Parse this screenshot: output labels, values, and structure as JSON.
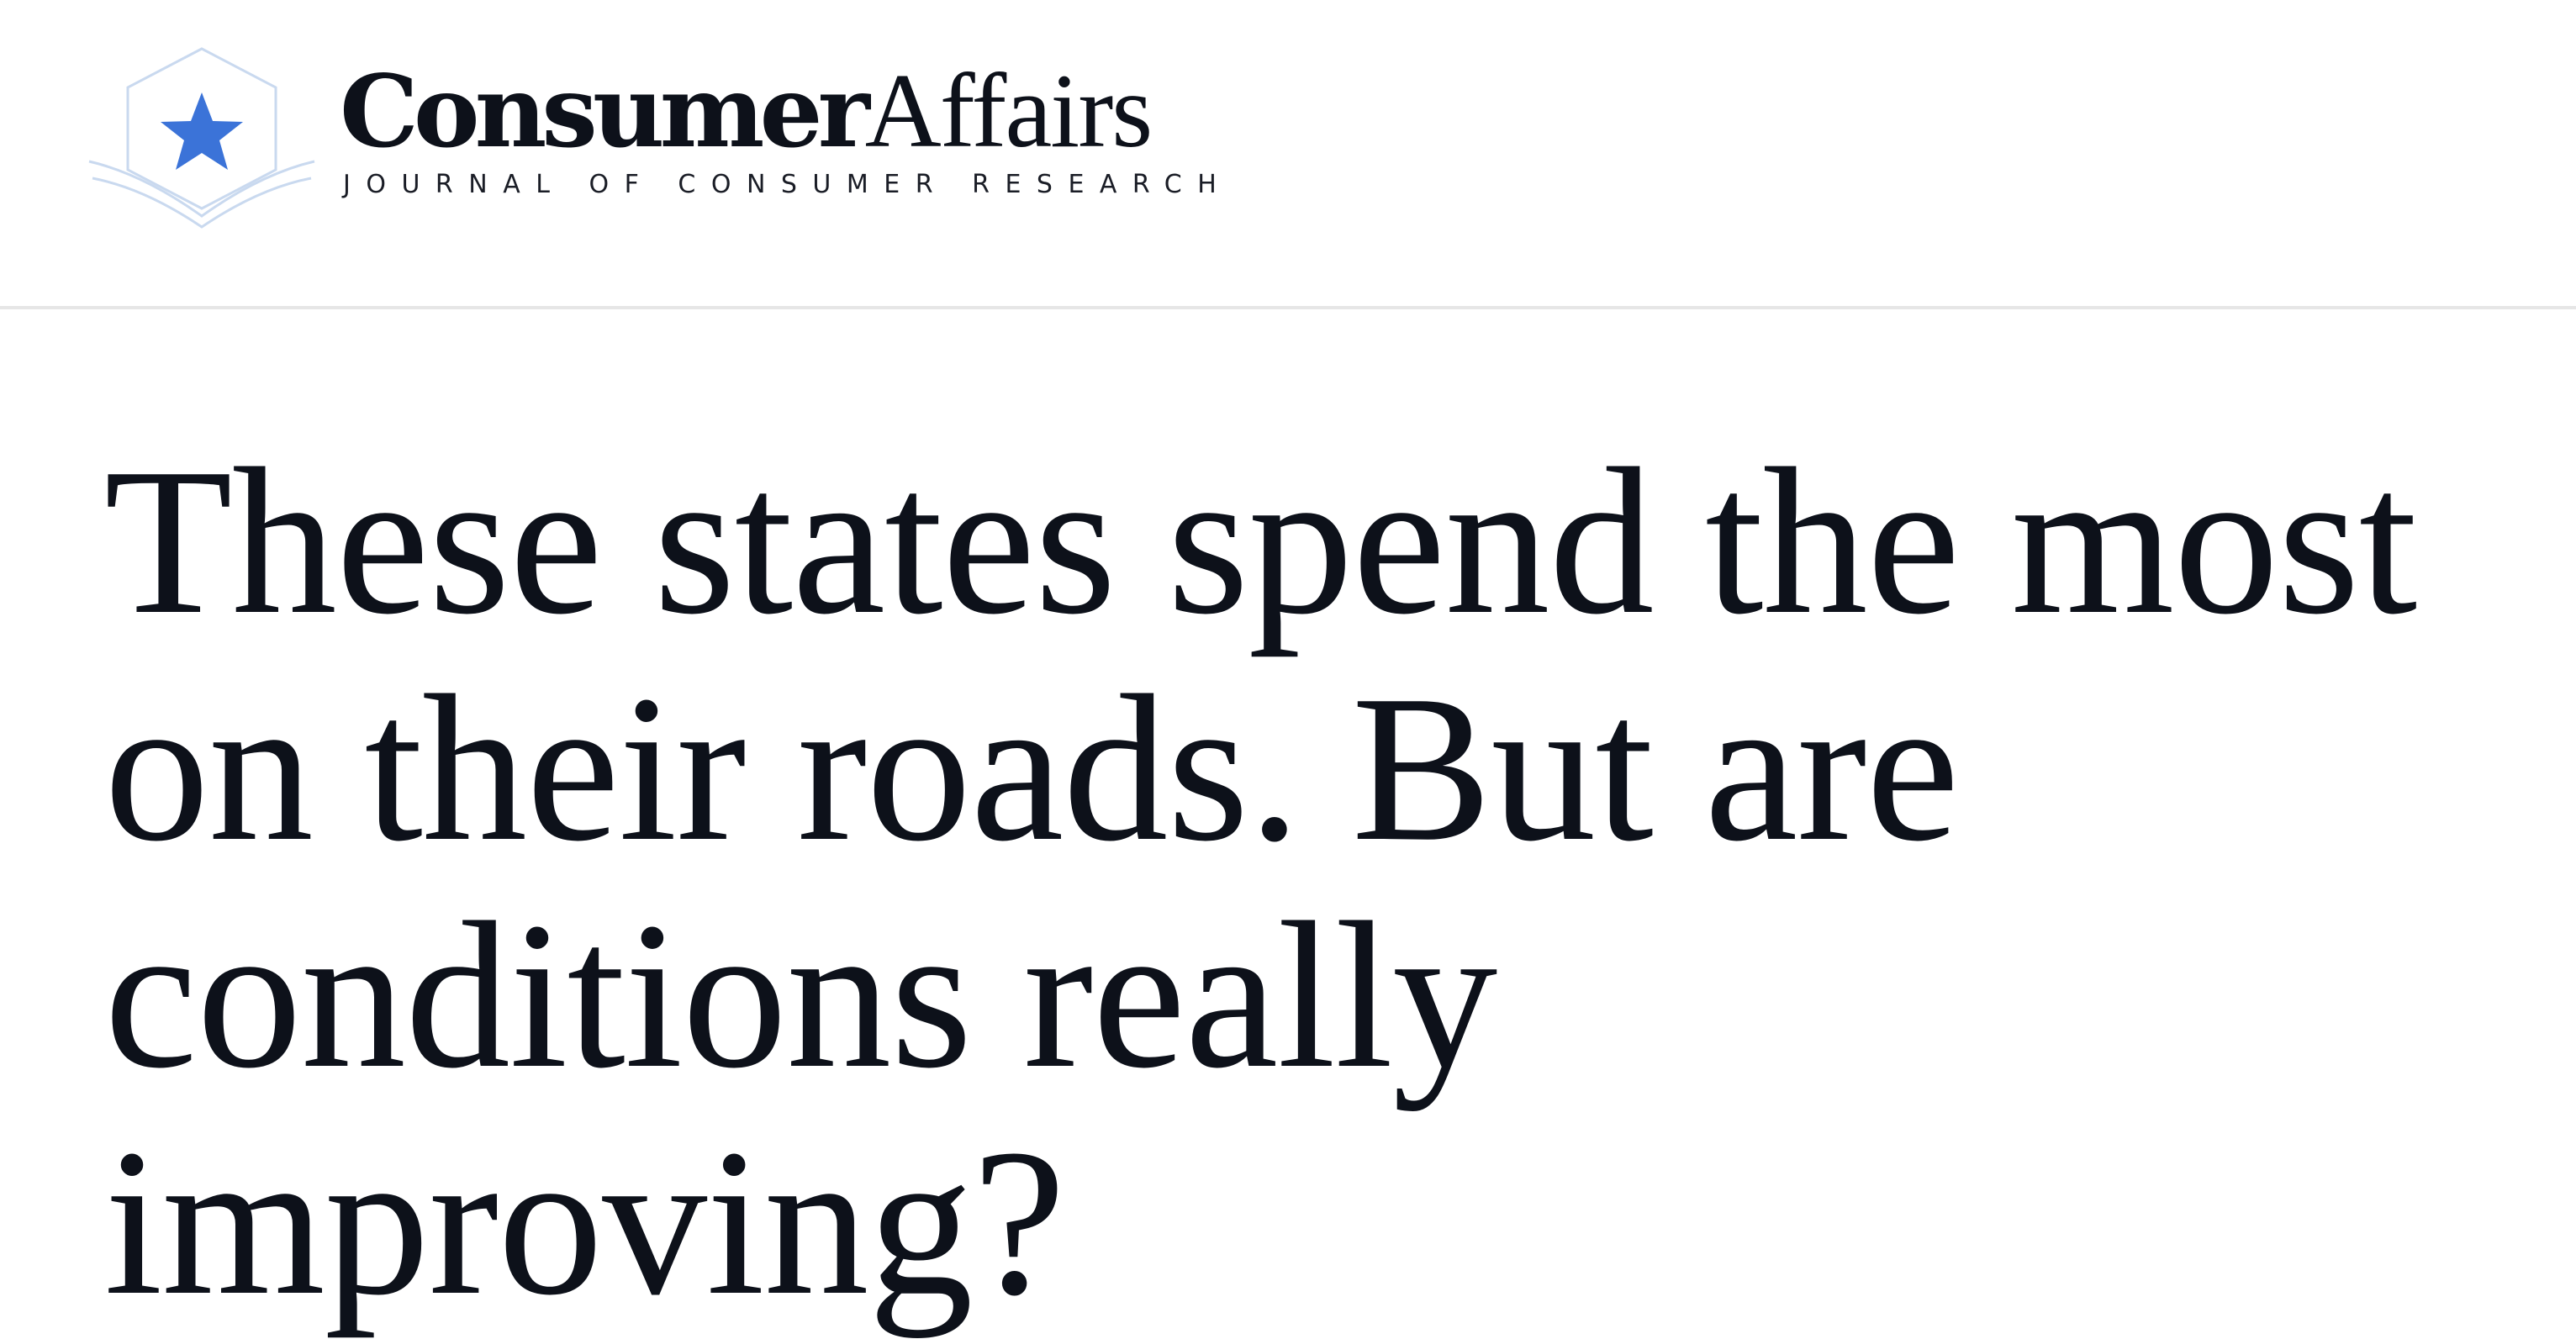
{
  "header": {
    "logo": {
      "icon": "star-book-icon",
      "star_color": "#3b73d8",
      "outline_color": "#c9d9ef"
    },
    "brand_bold": "Consumer",
    "brand_light": "Affairs",
    "tagline": "JOURNAL OF CONSUMER RESEARCH"
  },
  "article": {
    "headline": "These states spend the most on their roads. But are conditions really improving?"
  }
}
